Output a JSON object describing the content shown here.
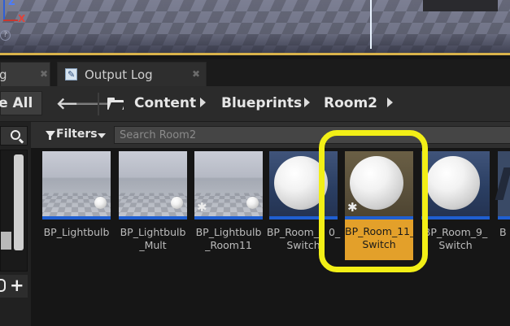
{
  "viewport": {
    "axis_z_label": "Z",
    "axis_x_label": "X",
    "help_glyph": "?"
  },
  "tabs": [
    {
      "label": "g",
      "icon": "log-icon"
    },
    {
      "label": "Output Log",
      "icon": "log-icon"
    }
  ],
  "toolbar": {
    "save_all_label": "ve All",
    "back_glyph": "🡐",
    "forward_glyph": "🡒"
  },
  "breadcrumb": [
    "Content",
    "Blueprints",
    "Room2"
  ],
  "filter": {
    "label": "Filters",
    "search_placeholder": "Search Room2"
  },
  "assets": [
    {
      "label": "BP_Lightbulb",
      "thumb": "floor",
      "starred": false,
      "selected": false
    },
    {
      "label": "BP_Lightbulb\n_Mult",
      "thumb": "floor",
      "starred": false,
      "selected": false
    },
    {
      "label": "BP_Lightbulb\n_Room11",
      "thumb": "floor",
      "starred": true,
      "selected": false
    },
    {
      "label": "BP_Room_1  0_\nSwitch",
      "thumb": "sphere",
      "starred": false,
      "selected": false
    },
    {
      "label": "BP_Room_11_\nSwitch",
      "thumb": "sphere",
      "starred": true,
      "selected": true
    },
    {
      "label": "BP_Room_9_\nSwitch",
      "thumb": "sphere",
      "starred": false,
      "selected": false
    }
  ],
  "partial_asset_label": "B",
  "colors": {
    "selection": "#e3a02a",
    "highlight": "#f2ef16",
    "asset_bar": "#1f5fd1"
  }
}
